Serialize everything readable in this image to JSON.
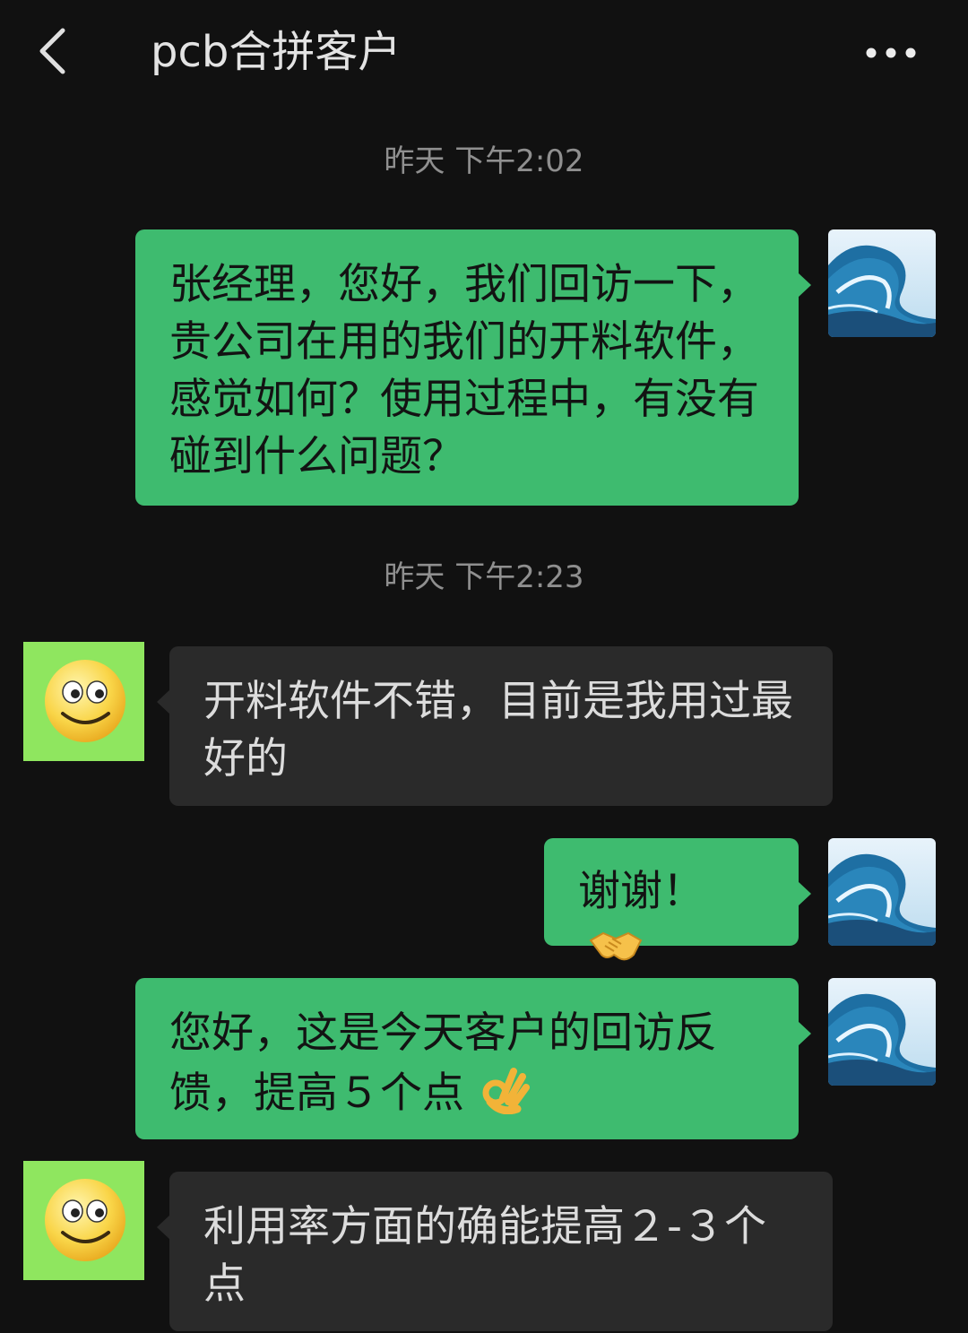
{
  "header": {
    "title": "pcb合拼客户",
    "back_icon": "chevron-left-icon",
    "more_icon": "more-dots-icon"
  },
  "messages": {
    "ts1": "昨天 下午2:02",
    "m1": "张经理，您好，我们回访一下，贵公司在用的我们的开料软件，感觉如何？使用过程中，有没有碰到什么问题？",
    "ts2": "昨天 下午2:23",
    "m2": "开料软件不错，目前是我用过最好的",
    "m3": "谢谢！",
    "m3_emoji": "handshake-emoji",
    "m4": "您好，这是今天客户的回访反馈，提高５个点",
    "m4_emoji": "ok-hand-emoji",
    "m5": "利用率方面的确能提高２-３个点"
  },
  "colors": {
    "background": "#111111",
    "outgoing_bubble": "#3ebb6f",
    "incoming_bubble": "#2a2a2a",
    "avatar_green": "#8fe65f"
  }
}
